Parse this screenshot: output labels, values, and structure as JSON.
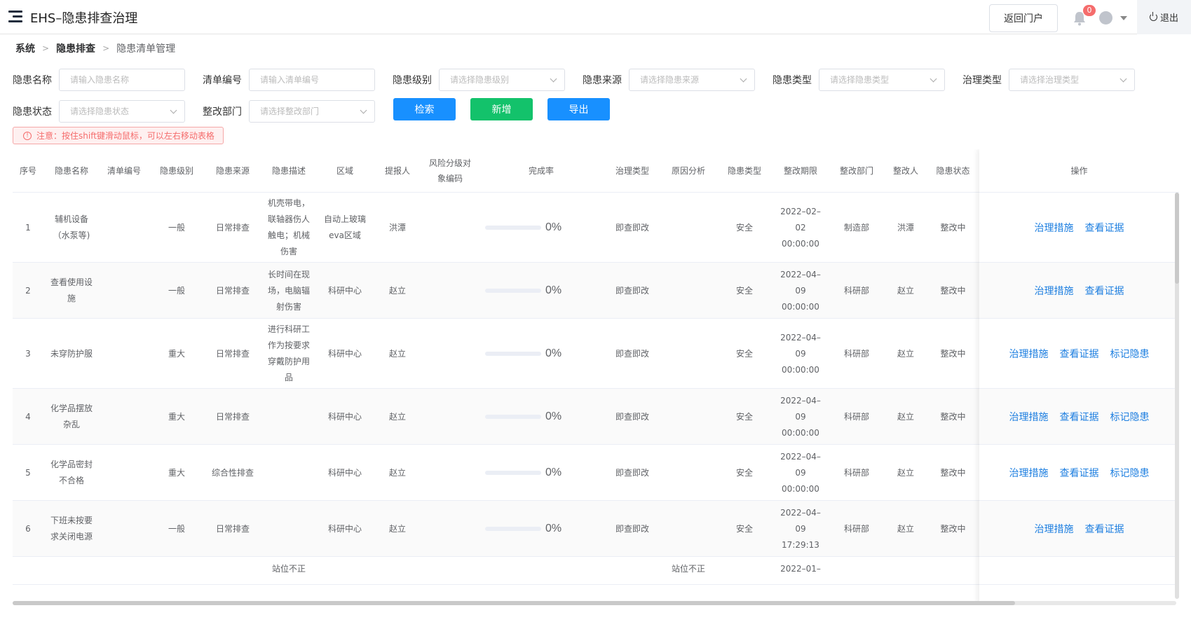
{
  "app": {
    "title": "EHS–隐患排查治理"
  },
  "header": {
    "portal_label": "返回门户",
    "notification_count": "0",
    "logout_label": "退出"
  },
  "breadcrumb": [
    "系统",
    "隐患排查",
    "隐患清单管理"
  ],
  "filters": {
    "name": {
      "label": "隐患名称",
      "placeholder": "请输入隐患名称"
    },
    "list_no": {
      "label": "清单编号",
      "placeholder": "请输入清单编号"
    },
    "level": {
      "label": "隐患级别",
      "placeholder": "请选择隐患级别"
    },
    "source": {
      "label": "隐患来源",
      "placeholder": "请选择隐患来源"
    },
    "type": {
      "label": "隐患类型",
      "placeholder": "请选择隐患类型"
    },
    "gov_type": {
      "label": "治理类型",
      "placeholder": "请选择治理类型"
    },
    "status": {
      "label": "隐患状态",
      "placeholder": "请选择隐患状态"
    },
    "dept": {
      "label": "整改部门",
      "placeholder": "请选择整改部门"
    }
  },
  "actions": {
    "search": "检索",
    "add": "新增",
    "export": "导出"
  },
  "notice": "注意：按住shift键滑动鼠标，可以左右移动表格",
  "table": {
    "columns": [
      "序号",
      "隐患名称",
      "清单编号",
      "隐患级别",
      "隐患来源",
      "隐患描述",
      "区域",
      "提报人",
      "风险分级对象编码",
      "完成率",
      "治理类型",
      "原因分析",
      "隐患类型",
      "整改期限",
      "整改部门",
      "整改人",
      "隐患状态",
      "操作"
    ],
    "rows": [
      {
        "no": "1",
        "name": "辅机设备（水泵等)",
        "list_no": "",
        "level": "一般",
        "source": "日常排查",
        "desc": "机壳带电，联轴器伤人触电；机械伤害",
        "area": "自动上玻璃eva区域",
        "reporter": "洪潭",
        "code": "",
        "rate": "0%",
        "rate_value": 0,
        "gov": "即查即改",
        "cause": "",
        "type": "安全",
        "deadline": "2022–02–02 00:00:00",
        "dept": "制造部",
        "person": "洪潭",
        "status": "整改中",
        "ops": [
          "治理措施",
          "查看证据"
        ]
      },
      {
        "no": "2",
        "name": "查看使用设施",
        "list_no": "",
        "level": "一般",
        "source": "日常排查",
        "desc": "长时间在现场，电脑辐射伤害",
        "area": "科研中心",
        "reporter": "赵立",
        "code": "",
        "rate": "0%",
        "rate_value": 0,
        "gov": "即查即改",
        "cause": "",
        "type": "安全",
        "deadline": "2022–04–09 00:00:00",
        "dept": "科研部",
        "person": "赵立",
        "status": "整改中",
        "ops": [
          "治理措施",
          "查看证据"
        ]
      },
      {
        "no": "3",
        "name": "未穿防护服",
        "list_no": "",
        "level": "重大",
        "source": "日常排查",
        "desc": "进行科研工作为按要求穿戴防护用品",
        "area": "科研中心",
        "reporter": "赵立",
        "code": "",
        "rate": "0%",
        "rate_value": 0,
        "gov": "即查即改",
        "cause": "",
        "type": "安全",
        "deadline": "2022–04–09 00:00:00",
        "dept": "科研部",
        "person": "赵立",
        "status": "整改中",
        "ops": [
          "治理措施",
          "查看证据",
          "标记隐患"
        ]
      },
      {
        "no": "4",
        "name": "化学品摆放杂乱",
        "list_no": "",
        "level": "重大",
        "source": "日常排查",
        "desc": "",
        "area": "科研中心",
        "reporter": "赵立",
        "code": "",
        "rate": "0%",
        "rate_value": 0,
        "gov": "即查即改",
        "cause": "",
        "type": "安全",
        "deadline": "2022–04–09 00:00:00",
        "dept": "科研部",
        "person": "赵立",
        "status": "整改中",
        "ops": [
          "治理措施",
          "查看证据",
          "标记隐患"
        ]
      },
      {
        "no": "5",
        "name": "化学品密封不合格",
        "list_no": "",
        "level": "重大",
        "source": "综合性排查",
        "desc": "",
        "area": "科研中心",
        "reporter": "赵立",
        "code": "",
        "rate": "0%",
        "rate_value": 0,
        "gov": "即查即改",
        "cause": "",
        "type": "安全",
        "deadline": "2022–04–09 00:00:00",
        "dept": "科研部",
        "person": "赵立",
        "status": "整改中",
        "ops": [
          "治理措施",
          "查看证据",
          "标记隐患"
        ]
      },
      {
        "no": "6",
        "name": "下班未按要求关闭电源",
        "list_no": "",
        "level": "一般",
        "source": "日常排查",
        "desc": "",
        "area": "科研中心",
        "reporter": "赵立",
        "code": "",
        "rate": "0%",
        "rate_value": 0,
        "gov": "即查即改",
        "cause": "",
        "type": "安全",
        "deadline": "2022–04–09 17:29:13",
        "dept": "科研部",
        "person": "赵立",
        "status": "整改中",
        "ops": [
          "治理措施",
          "查看证据"
        ]
      },
      {
        "no": "",
        "name": "",
        "list_no": "",
        "level": "",
        "source": "",
        "desc": "站位不正",
        "area": "",
        "reporter": "",
        "code": "",
        "rate": "",
        "rate_value": 0,
        "gov": "",
        "cause": "站位不正",
        "type": "",
        "deadline": "2022–01–",
        "dept": "",
        "person": "",
        "status": "",
        "ops": []
      }
    ]
  }
}
